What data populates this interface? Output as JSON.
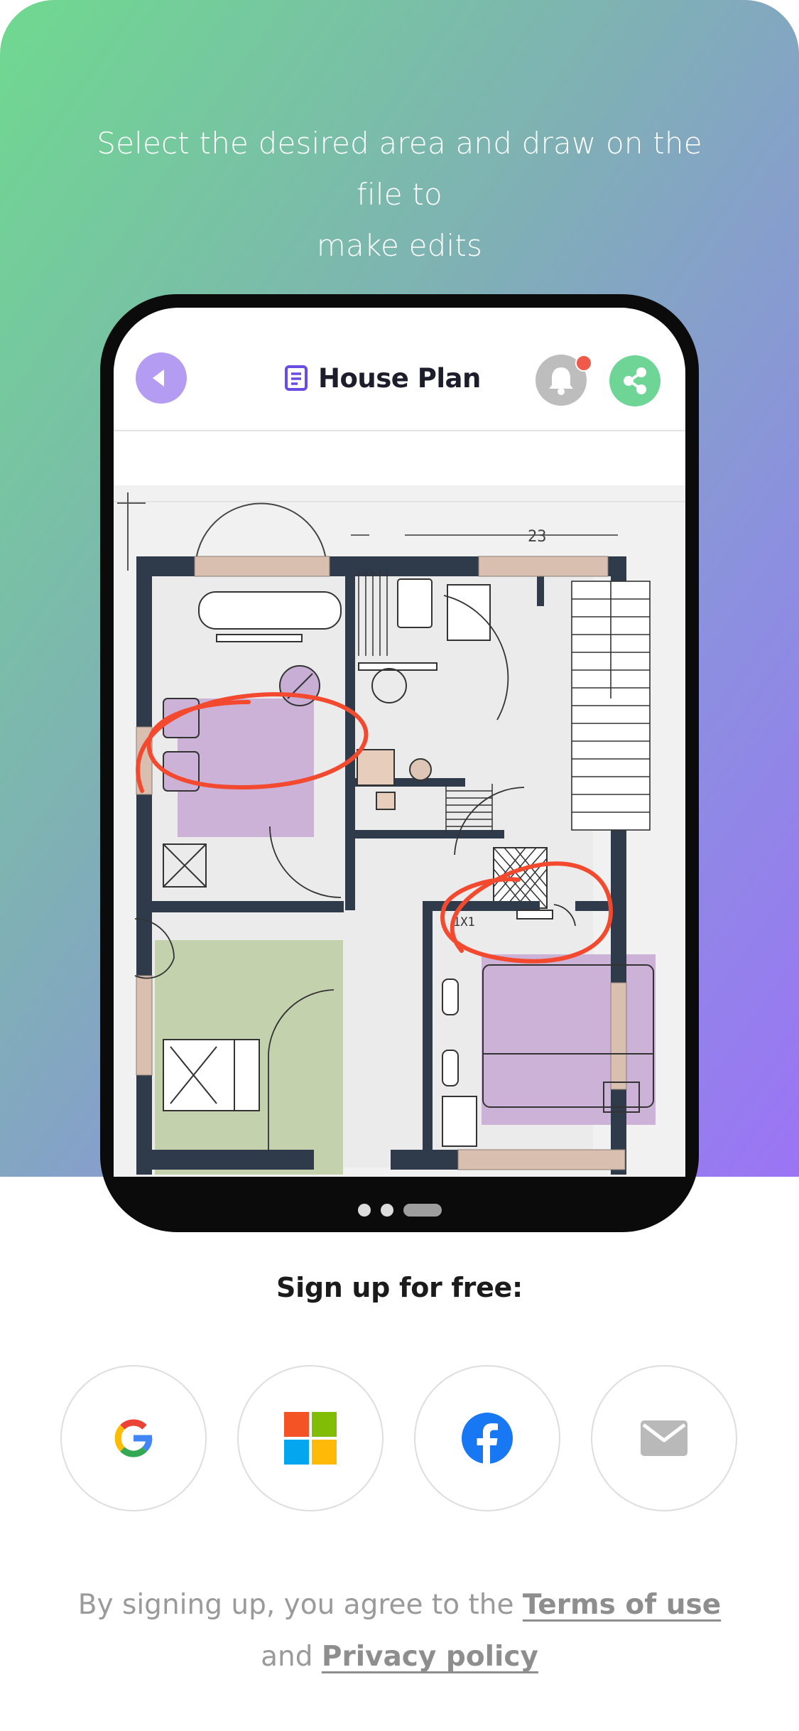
{
  "hero": {
    "line1": "Select the desired area and draw on the file to",
    "line2": "make edits"
  },
  "app": {
    "doc_title": "House Plan",
    "back_icon": "back-arrow-icon",
    "doc_icon": "document-icon",
    "bell_icon": "bell-icon",
    "share_icon": "share-icon",
    "plan_dimension_label": "23",
    "plan_room_label": "1X1"
  },
  "pager": {
    "count": 3,
    "active_index": 2
  },
  "signup": {
    "title": "Sign up for free:",
    "providers": [
      {
        "name": "Google",
        "icon": "google-icon"
      },
      {
        "name": "Microsoft",
        "icon": "microsoft-icon"
      },
      {
        "name": "Facebook",
        "icon": "facebook-icon"
      },
      {
        "name": "Email",
        "icon": "mail-icon"
      }
    ]
  },
  "legal": {
    "prefix": "By signing up, you agree to the",
    "terms": "Terms of use",
    "middle": "and",
    "privacy": "Privacy policy"
  },
  "colors": {
    "gradient_start": "#6fd98f",
    "gradient_end": "#9b74f5",
    "back_button": "#b49cf3",
    "share_button": "#6fd596",
    "annotation": "#f2492f",
    "notification_dot": "#ef5a4a"
  }
}
